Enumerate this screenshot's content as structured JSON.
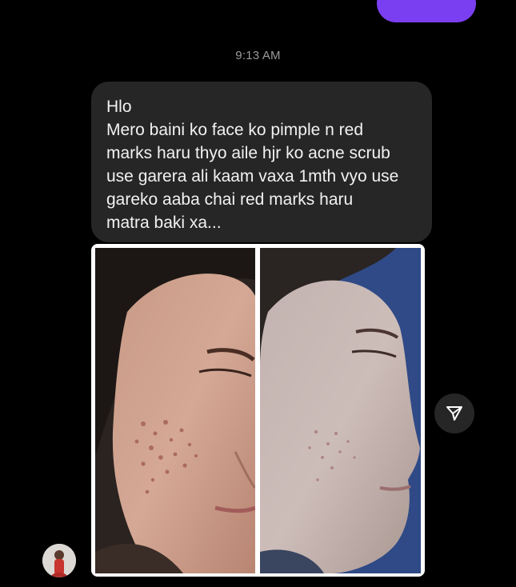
{
  "thread": {
    "timestamp": "9:13 AM"
  },
  "message": {
    "lines": [
      "Hlo",
      "Mero baini ko face ko pimple n red",
      "marks haru thyo aile hjr ko acne scrub",
      "use garera ali kaam vaxa 1mth vyo use",
      "gareko aaba chai red marks haru",
      "matra baki xa..."
    ]
  },
  "attachment": {
    "photos": [
      {
        "icon": "face-photo-before"
      },
      {
        "icon": "face-photo-after"
      }
    ]
  },
  "icons": {
    "share": "send-arrow-icon",
    "avatar": "user-avatar-icon"
  },
  "colors": {
    "background": "#000000",
    "received_bubble": "#262626",
    "sent_bubble": "#7b3ff2",
    "timestamp_text": "#9a9a9a",
    "message_text": "#f2f2f2"
  }
}
